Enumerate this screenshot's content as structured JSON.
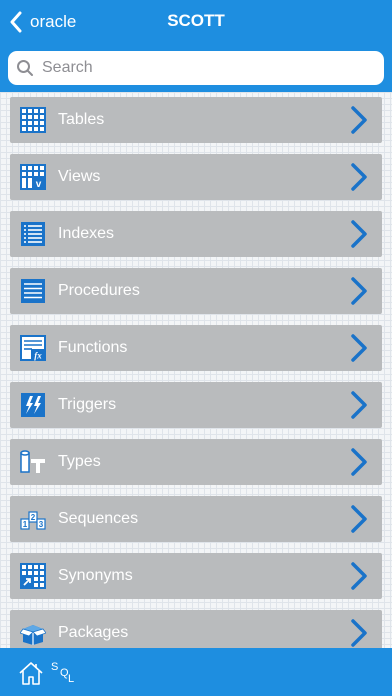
{
  "navbar": {
    "back_label": "oracle",
    "title": "SCOTT"
  },
  "search": {
    "placeholder": "Search"
  },
  "items": [
    {
      "label": "Tables",
      "icon": "table-grid-icon"
    },
    {
      "label": "Views",
      "icon": "view-grid-icon"
    },
    {
      "label": "Indexes",
      "icon": "index-list-icon"
    },
    {
      "label": "Procedures",
      "icon": "procedure-lines-icon"
    },
    {
      "label": "Functions",
      "icon": "function-fx-icon"
    },
    {
      "label": "Triggers",
      "icon": "trigger-lightning-icon"
    },
    {
      "label": "Types",
      "icon": "type-cylinder-icon"
    },
    {
      "label": "Sequences",
      "icon": "sequence-123-icon"
    },
    {
      "label": "Synonyms",
      "icon": "synonym-grid-arrow-icon"
    },
    {
      "label": "Packages",
      "icon": "package-box-icon"
    }
  ],
  "tabbar": {
    "sql_letters": [
      "S",
      "Q",
      "L"
    ]
  },
  "colors": {
    "accent": "#1e8ee0",
    "row_bg": "#b9bbbd",
    "icon_blue": "#1a73c9"
  }
}
